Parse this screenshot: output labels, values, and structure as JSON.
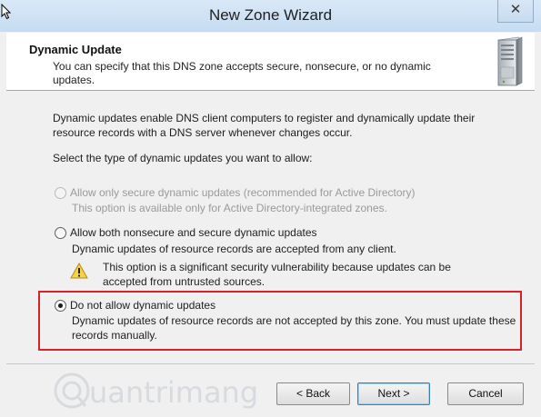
{
  "window": {
    "title": "New Zone Wizard",
    "close_glyph": "✕"
  },
  "header": {
    "title": "Dynamic Update",
    "description": "You can specify that this DNS zone accepts secure, nonsecure, or no dynamic updates.",
    "icon": "server-icon"
  },
  "body": {
    "intro": "Dynamic updates enable DNS client computers to register and dynamically update their resource records with a DNS server whenever changes occur.",
    "prompt": "Select the type of dynamic updates you want to allow:",
    "options": [
      {
        "label": "Allow only secure dynamic updates (recommended for Active Directory)",
        "description": "This option is available only for Active Directory-integrated zones.",
        "enabled": false,
        "selected": false
      },
      {
        "label": "Allow both nonsecure and secure dynamic updates",
        "description": "Dynamic updates of resource records are accepted from any client.",
        "warning": "This option is a significant security vulnerability because updates can be accepted from untrusted sources.",
        "enabled": true,
        "selected": false
      },
      {
        "label": "Do not allow dynamic updates",
        "description": "Dynamic updates of resource records are not accepted by this zone. You must update these records manually.",
        "enabled": true,
        "selected": true
      }
    ]
  },
  "buttons": {
    "back": "< Back",
    "next": "Next >",
    "cancel": "Cancel"
  },
  "watermark": {
    "text": "uantrimang"
  },
  "colors": {
    "highlight_border": "#d8222b",
    "title_bar": "#d9e8f7",
    "default_button_border": "#3c7fb1"
  }
}
